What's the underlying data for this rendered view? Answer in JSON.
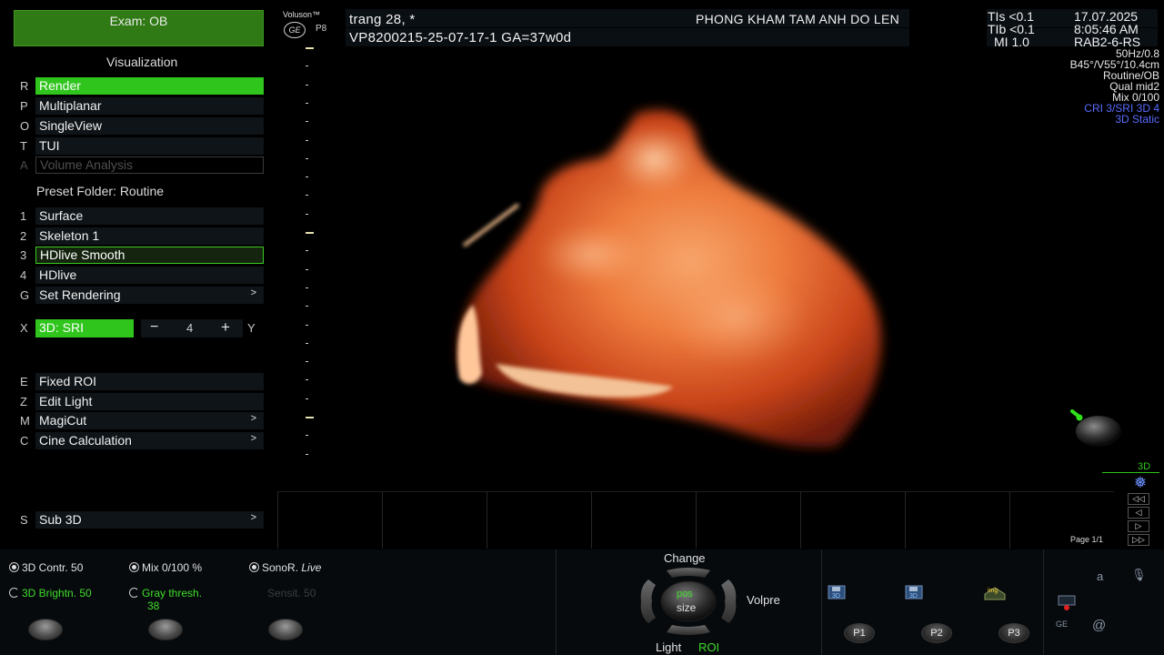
{
  "exam": {
    "label": "Exam:  OB"
  },
  "visualization": {
    "title": "Visualization",
    "items": [
      {
        "key": "R",
        "label": "Render",
        "state": "active"
      },
      {
        "key": "P",
        "label": "Multiplanar",
        "state": "normal"
      },
      {
        "key": "O",
        "label": "SingleView",
        "state": "normal"
      },
      {
        "key": "T",
        "label": "TUI",
        "state": "normal"
      },
      {
        "key": "A",
        "label": "Volume Analysis",
        "state": "disabled"
      }
    ]
  },
  "preset": {
    "title": "Preset Folder: Routine",
    "items": [
      {
        "key": "1",
        "label": "Surface",
        "state": "normal"
      },
      {
        "key": "2",
        "label": "Skeleton 1",
        "state": "normal"
      },
      {
        "key": "3",
        "label": "HDlive Smooth",
        "state": "selected"
      },
      {
        "key": "4",
        "label": "HDlive",
        "state": "normal"
      },
      {
        "key": "G",
        "label": "Set Rendering",
        "state": "normal",
        "arrow": ">"
      }
    ]
  },
  "sri": {
    "key": "X",
    "label": "3D: SRI",
    "minus": "−",
    "value": "4",
    "plus": "+",
    "axis": "Y"
  },
  "tools": {
    "items": [
      {
        "key": "E",
        "label": "Fixed ROI",
        "arrow": ""
      },
      {
        "key": "Z",
        "label": "Edit Light",
        "arrow": ""
      },
      {
        "key": "M",
        "label": "MagiCut",
        "arrow": ">"
      },
      {
        "key": "C",
        "label": "Cine Calculation",
        "arrow": ">"
      }
    ]
  },
  "sub3d": {
    "key": "S",
    "label": "Sub 3D",
    "arrow": ">"
  },
  "header": {
    "brand": "Voluson™",
    "ge": "GE",
    "probe": "P8",
    "patient": "trang 28,  *",
    "patient_id": "VP8200215-25-07-17-1  GA=37w0d",
    "clinic": "PHONG KHAM TAM ANH DO LEN",
    "tis": "TIs <0.1",
    "tib": "TIb <0.1",
    "mi": "MI  1.0",
    "date": "17.07.2025",
    "time": "8:05:46 AM",
    "probe_code": "RAB2-6-RS"
  },
  "params": {
    "line1": "50Hz/0.8",
    "line2": "B45°/V55°/10.4cm",
    "line3": "Routine/OB",
    "line4": "Qual mid2",
    "line5": "Mix 0/100",
    "line6": "CRI 3/SRI 3D 4",
    "line7": "3D Static"
  },
  "view": {
    "mode_label": "3D",
    "page": "Page 1/1"
  },
  "cine_controls": [
    "◁◁",
    "◁",
    "▷",
    "▷▷"
  ],
  "bottom": {
    "contrast": "3D Contr. 50",
    "mix": "Mix 0/100 %",
    "sonor_prefix": "SonoR. ",
    "sonor_mode": "Live",
    "brightness": "3D Brightn. 50",
    "gray_thresh_label": "Gray thresh.",
    "gray_thresh_value": "38",
    "sensit": "Sensit. 50",
    "change": "Change",
    "pos": "pos",
    "size": "size",
    "volpre": "Volpre",
    "light": "Light",
    "roi": "ROI",
    "save1": "3D",
    "save2": "3D",
    "img": "img",
    "p1": "P1",
    "p2": "P2",
    "p3": "P3",
    "kbd": "a",
    "at": "@",
    "ge": "GE"
  },
  "colors": {
    "accent_green": "#2fc51c",
    "exam_green": "#2f7a14",
    "param_blue": "#5a6cff",
    "render_flesh": "#e4662a"
  }
}
